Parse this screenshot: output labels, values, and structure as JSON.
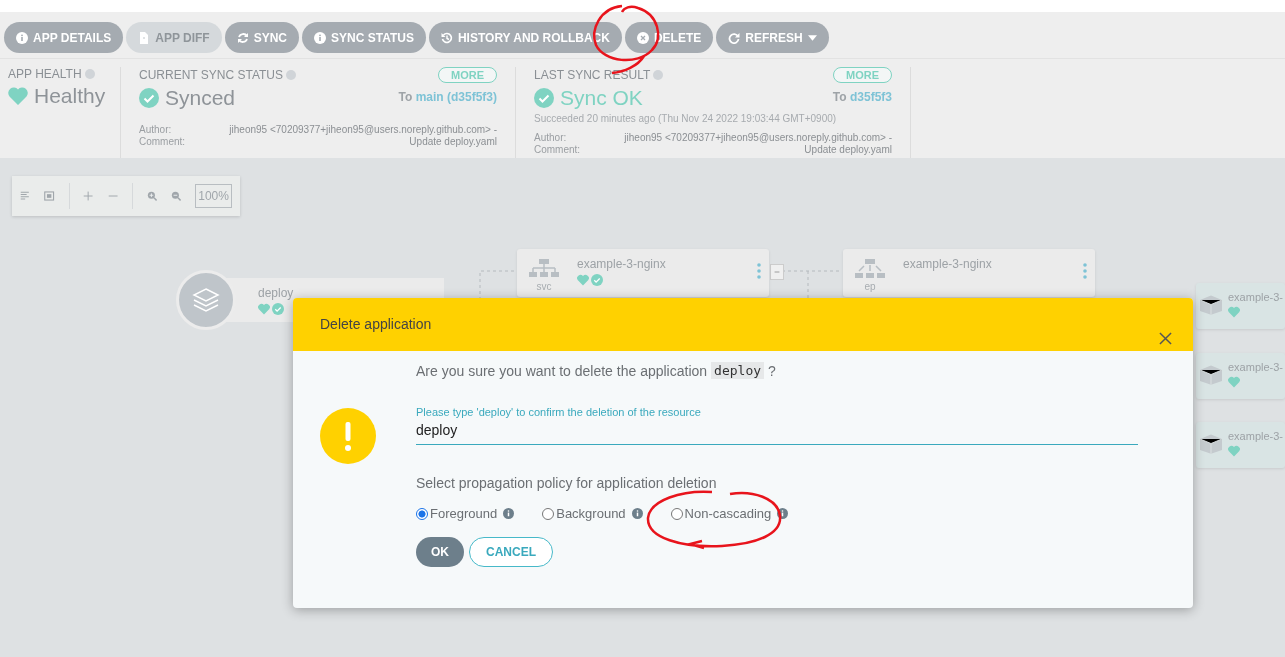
{
  "toolbar": [
    {
      "label": "APP DETAILS",
      "kind": "info",
      "disabled": false
    },
    {
      "label": "APP DIFF",
      "kind": "file",
      "disabled": true
    },
    {
      "label": "SYNC",
      "kind": "sync",
      "disabled": false
    },
    {
      "label": "SYNC STATUS",
      "kind": "info",
      "disabled": false
    },
    {
      "label": "HISTORY AND ROLLBACK",
      "kind": "history",
      "disabled": false
    },
    {
      "label": "DELETE",
      "kind": "delete",
      "disabled": false
    },
    {
      "label": "REFRESH",
      "kind": "refresh",
      "disabled": false,
      "dropdown": true
    }
  ],
  "app_health": {
    "label": "APP HEALTH",
    "value": "Healthy"
  },
  "current_sync": {
    "label": "CURRENT SYNC STATUS",
    "more": "MORE",
    "value": "Synced",
    "to": "To",
    "revision": "main (d35f5f3)",
    "author_label": "Author:",
    "author": "jiheon95 <70209377+jiheon95@users.noreply.github.com> -",
    "comment_label": "Comment:",
    "comment": "Update deploy.yaml"
  },
  "last_sync": {
    "label": "LAST SYNC RESULT",
    "more": "MORE",
    "value": "Sync OK",
    "to": "To",
    "revision": "d35f5f3",
    "detail": "Succeeded 20 minutes ago (Thu Nov 24 2022 19:03:44 GMT+0900)",
    "author_label": "Author:",
    "author": "jiheon95 <70209377+jiheon95@users.noreply.github.com> -",
    "comment_label": "Comment:",
    "comment": "Update deploy.yaml"
  },
  "graph_toolbar": {
    "zoom": "100%"
  },
  "nodes": [
    {
      "name": "deploy",
      "kind": "app",
      "healthy": true,
      "synced": true
    },
    {
      "name": "example-3-nginx",
      "kind": "svc",
      "type_label": "svc",
      "healthy": true,
      "synced": true
    },
    {
      "name": "example-3-nginx",
      "kind": "ep",
      "type_label": "ep"
    },
    {
      "name": "example-3-",
      "kind": "pod",
      "healthy": true
    },
    {
      "name": "example-3-",
      "kind": "pod",
      "healthy": true
    },
    {
      "name": "example-3-",
      "kind": "pod",
      "healthy": true
    }
  ],
  "dialog": {
    "title": "Delete application",
    "question": "Are you sure you want to delete the application",
    "app_name": "deploy",
    "question_end": "?",
    "field_label": "Please type 'deploy' to confirm the deletion of the resource",
    "value": "deploy",
    "policy_label": "Select propagation policy for application deletion",
    "options": [
      {
        "label": "Foreground",
        "selected": true
      },
      {
        "label": "Background",
        "selected": false
      },
      {
        "label": "Non-cascading",
        "selected": false
      }
    ],
    "ok": "OK",
    "cancel": "CANCEL"
  }
}
